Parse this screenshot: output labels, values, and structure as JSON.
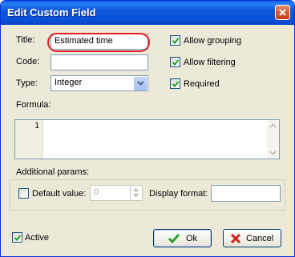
{
  "window": {
    "title": "Edit Custom Field"
  },
  "fields": {
    "title": {
      "label": "Title:",
      "value": "Estimated time"
    },
    "code": {
      "label": "Code:",
      "value": ""
    },
    "type": {
      "label": "Type:",
      "value": "Integer"
    },
    "formula": {
      "label": "Formula:",
      "line_number": "1"
    }
  },
  "options": {
    "allow_grouping": {
      "label": "Allow grouping",
      "checked": true
    },
    "allow_filtering": {
      "label": "Allow filtering",
      "checked": true
    },
    "required": {
      "label": "Required",
      "checked": true
    }
  },
  "additional": {
    "heading": "Additional params:",
    "default_value": {
      "label": "Default value:",
      "value": "0",
      "checked": false
    },
    "display_format": {
      "label": "Display format:",
      "value": ""
    }
  },
  "footer": {
    "active": {
      "label": "Active",
      "checked": true
    },
    "ok_label": "Ok",
    "cancel_label": "Cancel"
  },
  "colors": {
    "titlebar": "#0a5fe8",
    "highlight": "#e0202a",
    "dialog": "#ece9d8"
  },
  "icons": [
    "close-icon",
    "checkmark-icon",
    "chevron-down-icon",
    "cancel-x-icon"
  ]
}
